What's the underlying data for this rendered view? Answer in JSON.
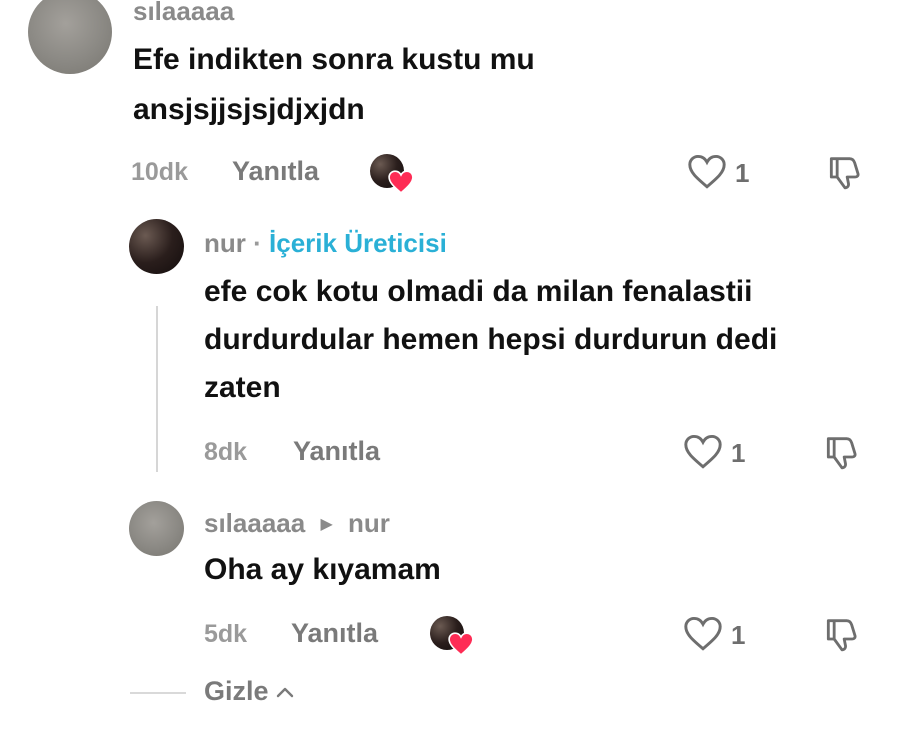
{
  "comments": [
    {
      "username": "sılaaaaa",
      "text_line1": "Efe indikten sonra kustu mu",
      "text_line2": "ansjsjjsjsjdjxjdn",
      "time": "10dk",
      "reply_label": "Yanıtla",
      "likes": "1"
    },
    {
      "username": "nur",
      "separator": "·",
      "creator_label": "İçerik Üreticisi",
      "text_line1": "efe cok kotu olmadi da milan fenalastii",
      "text_line2": "durdurdular hemen hepsi durdurun dedi",
      "text_line3": "zaten",
      "time": "8dk",
      "reply_label": "Yanıtla",
      "likes": "1"
    },
    {
      "username": "sılaaaaa",
      "reply_to": "nur",
      "text_line1": "Oha ay kıyamam",
      "time": "5dk",
      "reply_label": "Yanıtla",
      "likes": "1"
    }
  ],
  "hide_label": "Gizle",
  "colors": {
    "creator_accent": "#2ab0d6",
    "heart_red": "#fe2c55"
  }
}
